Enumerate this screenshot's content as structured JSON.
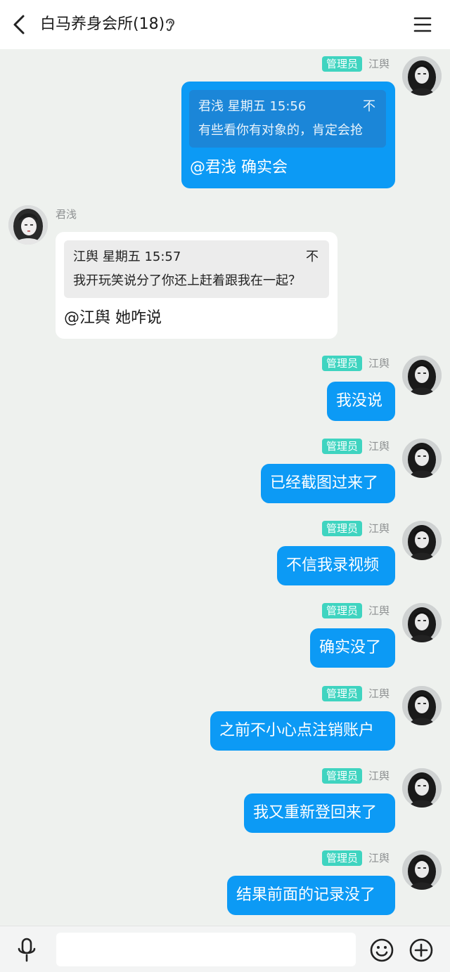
{
  "header": {
    "title": "白马养身会所(18)",
    "back_icon": "chevron-left-icon",
    "ear_icon": "ear-icon",
    "menu_icon": "menu-icon"
  },
  "messages": [
    {
      "direction": "out",
      "badge": "管理员",
      "sender": "江舆",
      "quote": {
        "author_time": "君浅 星期五 15:56",
        "text": "有些看你有对象的，肯定会抢",
        "arrow_glyph": "不"
      },
      "text": "@君浅 确实会"
    },
    {
      "direction": "in",
      "sender": "君浅",
      "quote": {
        "author_time": "江舆 星期五 15:57",
        "text": "我开玩笑说分了你还上赶着跟我在一起？",
        "arrow_glyph": "不"
      },
      "text": "@江舆 她咋说"
    },
    {
      "direction": "out",
      "badge": "管理员",
      "sender": "江舆",
      "text": "我没说"
    },
    {
      "direction": "out",
      "badge": "管理员",
      "sender": "江舆",
      "text": "已经截图过来了"
    },
    {
      "direction": "out",
      "badge": "管理员",
      "sender": "江舆",
      "text": "不信我录视频"
    },
    {
      "direction": "out",
      "badge": "管理员",
      "sender": "江舆",
      "text": "确实没了"
    },
    {
      "direction": "out",
      "badge": "管理员",
      "sender": "江舆",
      "text": "之前不小心点注销账户"
    },
    {
      "direction": "out",
      "badge": "管理员",
      "sender": "江舆",
      "text": "我又重新登回来了"
    },
    {
      "direction": "out",
      "badge": "管理员",
      "sender": "江舆",
      "text": "结果前面的记录没了"
    }
  ],
  "input": {
    "placeholder": ""
  },
  "colors": {
    "background": "#eef1ee",
    "outgoing_bubble": "#0c9af5",
    "incoming_bubble": "#ffffff",
    "admin_badge": "#3fd4c0"
  }
}
